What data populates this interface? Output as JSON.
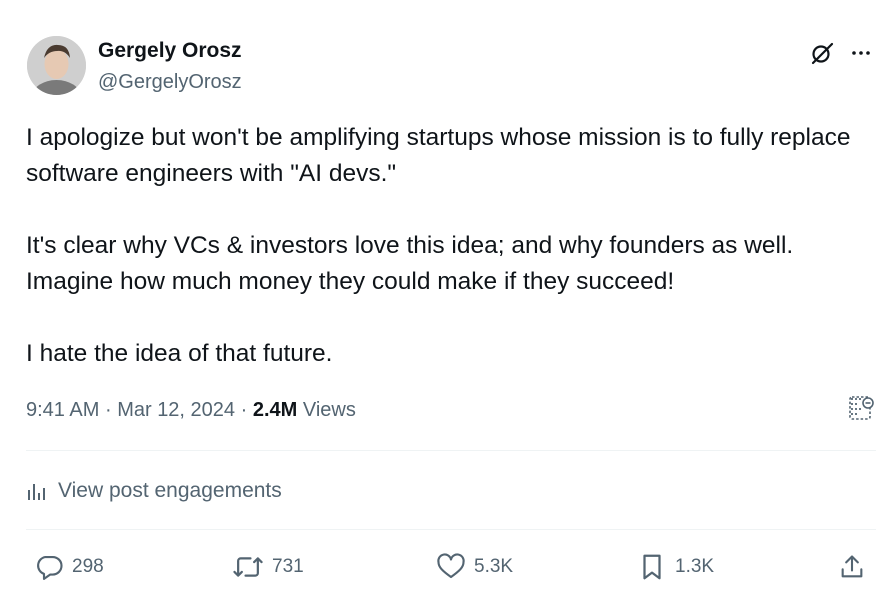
{
  "author": {
    "name": "Gergely Orosz",
    "handle": "@GergelyOrosz",
    "avatar_icon": "person-avatar"
  },
  "top_icons": [
    "grok-icon",
    "more-icon"
  ],
  "tweet": {
    "paragraphs": [
      "I apologize but won't be amplifying startups whose mission is to fully replace software engineers with \"AI devs.\"",
      "It's clear why VCs & investors love this idea; and why founders as well. Imagine how much money they could make if they succeed!",
      "I hate the idea of that future."
    ]
  },
  "meta": {
    "time": "9:41 AM",
    "sep1": "·",
    "date": "Mar 12, 2024",
    "sep2": "·",
    "views_count": "2.4M",
    "views_label": "Views"
  },
  "engagements_label": "View post engagements",
  "actions": {
    "replies": "298",
    "reposts": "731",
    "likes": "5.3K",
    "bookmarks": "1.3K"
  },
  "colors": {
    "text_primary": "#0f1419",
    "text_secondary": "#536471",
    "divider": "#eff3f4"
  }
}
